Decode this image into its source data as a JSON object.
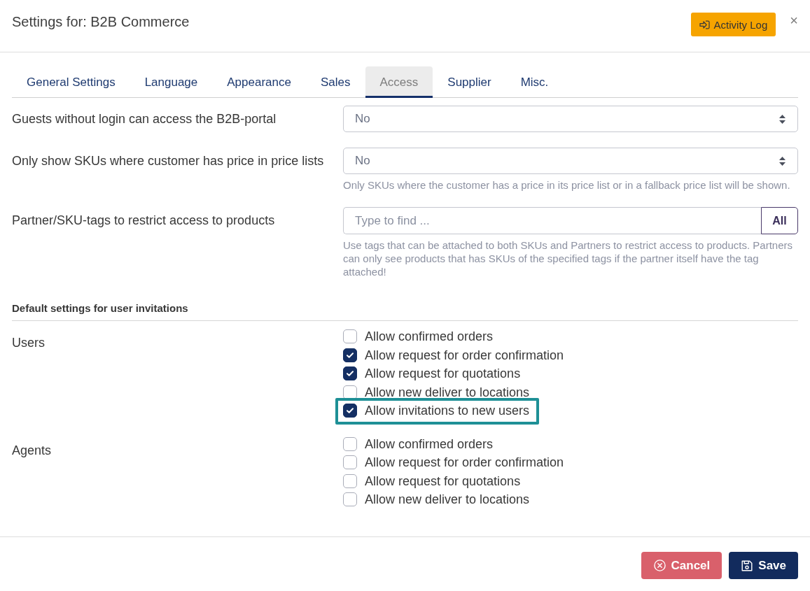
{
  "dialog": {
    "title": "Settings for: B2B Commerce",
    "activity_log_button": "Activity Log",
    "close_glyph": "×"
  },
  "tabs": [
    {
      "label": "General Settings",
      "selected": false
    },
    {
      "label": "Language",
      "selected": false
    },
    {
      "label": "Appearance",
      "selected": false
    },
    {
      "label": "Sales",
      "selected": false
    },
    {
      "label": "Access",
      "selected": true
    },
    {
      "label": "Supplier",
      "selected": false
    },
    {
      "label": "Misc.",
      "selected": false
    }
  ],
  "fields": [
    {
      "kind": "select",
      "label": "Guests without login can access the B2B-portal",
      "value": "No"
    },
    {
      "kind": "select",
      "label": "Only show SKUs where customer has price in price lists",
      "value": "No",
      "help": "Only SKUs where the customer has a price in its price list or in a fallback price list will be shown."
    },
    {
      "kind": "tag_search",
      "label": "Partner/SKU-tags to restrict access to products",
      "placeholder": "Type to find ...",
      "button": "All",
      "help": "Use tags that can be attached to both SKUs and Partners to restrict access to products. Partners can only see products that has SKUs of the specified tags if the partner itself have the tag attached!"
    }
  ],
  "invitation_defaults": {
    "heading": "Default settings for user invitations",
    "groups": [
      {
        "label": "Users",
        "options": [
          {
            "label": "Allow confirmed orders",
            "checked": false,
            "highlighted": false
          },
          {
            "label": "Allow request for order confirmation",
            "checked": true,
            "highlighted": false
          },
          {
            "label": "Allow request for quotations",
            "checked": true,
            "highlighted": false
          },
          {
            "label": "Allow new deliver to locations",
            "checked": false,
            "highlighted": false
          },
          {
            "label": "Allow invitations to new users",
            "checked": true,
            "highlighted": true
          }
        ]
      },
      {
        "label": "Agents",
        "options": [
          {
            "label": "Allow confirmed orders",
            "checked": false,
            "highlighted": false
          },
          {
            "label": "Allow request for order confirmation",
            "checked": false,
            "highlighted": false
          },
          {
            "label": "Allow request for quotations",
            "checked": false,
            "highlighted": false
          },
          {
            "label": "Allow new deliver to locations",
            "checked": false,
            "highlighted": false
          }
        ]
      }
    ]
  },
  "footer": {
    "buttons": [
      {
        "kind": "cancel",
        "label": "Cancel"
      },
      {
        "kind": "save",
        "label": "Save"
      }
    ]
  }
}
